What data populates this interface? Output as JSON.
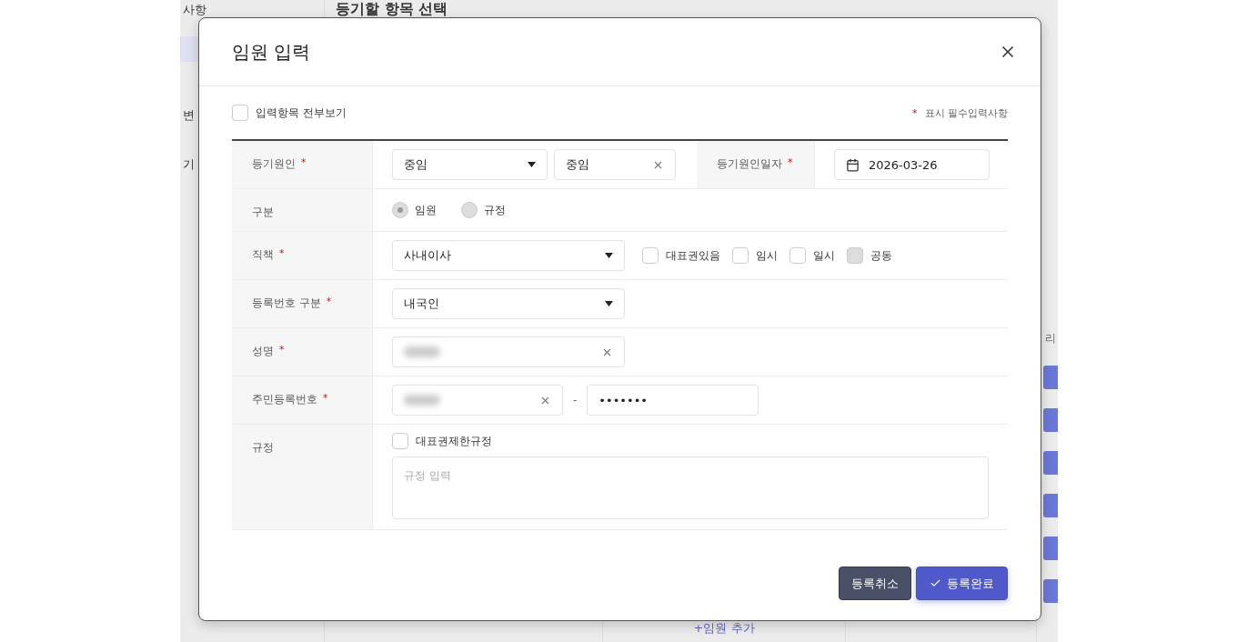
{
  "background": {
    "sidebar": [
      {
        "label": "사항",
        "selected": false
      },
      {
        "selected": true
      },
      {
        "label": "변",
        "selected": false
      },
      {
        "label": "기",
        "selected": false
      }
    ],
    "title": "등기할 항목 선택",
    "table_header": "리",
    "row_buttons": [
      {
        "kind": "button"
      },
      {
        "kind": "button"
      },
      {
        "kind": "button"
      },
      {
        "kind": "button"
      },
      {
        "kind": "button"
      },
      {
        "kind": "button"
      }
    ],
    "add_link": "+임원 추가"
  },
  "dialog": {
    "title": "임원 입력",
    "show_all": {
      "label": "입력항목 전부보기",
      "checked": false
    },
    "required_note": {
      "mark": "*",
      "text": "표시 필수입력사항"
    },
    "rows": [
      {
        "kind": "cause",
        "label": "등기원인",
        "mark": "*",
        "select": {
          "value": "중임"
        },
        "text": {
          "value": "중임"
        },
        "date_label": "등기원인일자",
        "date_mark": "*",
        "date": {
          "value": "2026-03-26"
        }
      },
      {
        "kind": "radio",
        "label": "구분",
        "options": [
          {
            "label": "임원",
            "selected": true
          },
          {
            "label": "규정",
            "selected": false
          }
        ]
      },
      {
        "kind": "position",
        "label": "직책",
        "mark": "*",
        "select": {
          "value": "사내이사"
        },
        "checks": [
          {
            "label": "대표권있음",
            "checked": false,
            "disabled": false
          },
          {
            "label": "임시",
            "checked": false,
            "disabled": false
          },
          {
            "label": "일시",
            "checked": false,
            "disabled": false
          },
          {
            "label": "공동",
            "checked": false,
            "disabled": true
          }
        ]
      },
      {
        "kind": "select",
        "label": "등록번호 구분",
        "mark": "*",
        "select": {
          "value": "내국인"
        }
      },
      {
        "kind": "name",
        "label": "성명",
        "mark": "*",
        "field": {
          "redacted": true
        }
      },
      {
        "kind": "id",
        "label": "주민등록번호",
        "mark": "*",
        "first": {
          "redacted": true
        },
        "separator": "-",
        "second": {
          "value": "•••••••"
        }
      },
      {
        "kind": "rule",
        "label": "규정",
        "check": {
          "label": "대표권제한규정",
          "checked": false
        },
        "textarea": {
          "placeholder": "규정 입력"
        }
      }
    ],
    "buttons": [
      {
        "kind": "cancel",
        "label": "등록취소"
      },
      {
        "kind": "confirm",
        "label": "등록완료"
      }
    ]
  }
}
